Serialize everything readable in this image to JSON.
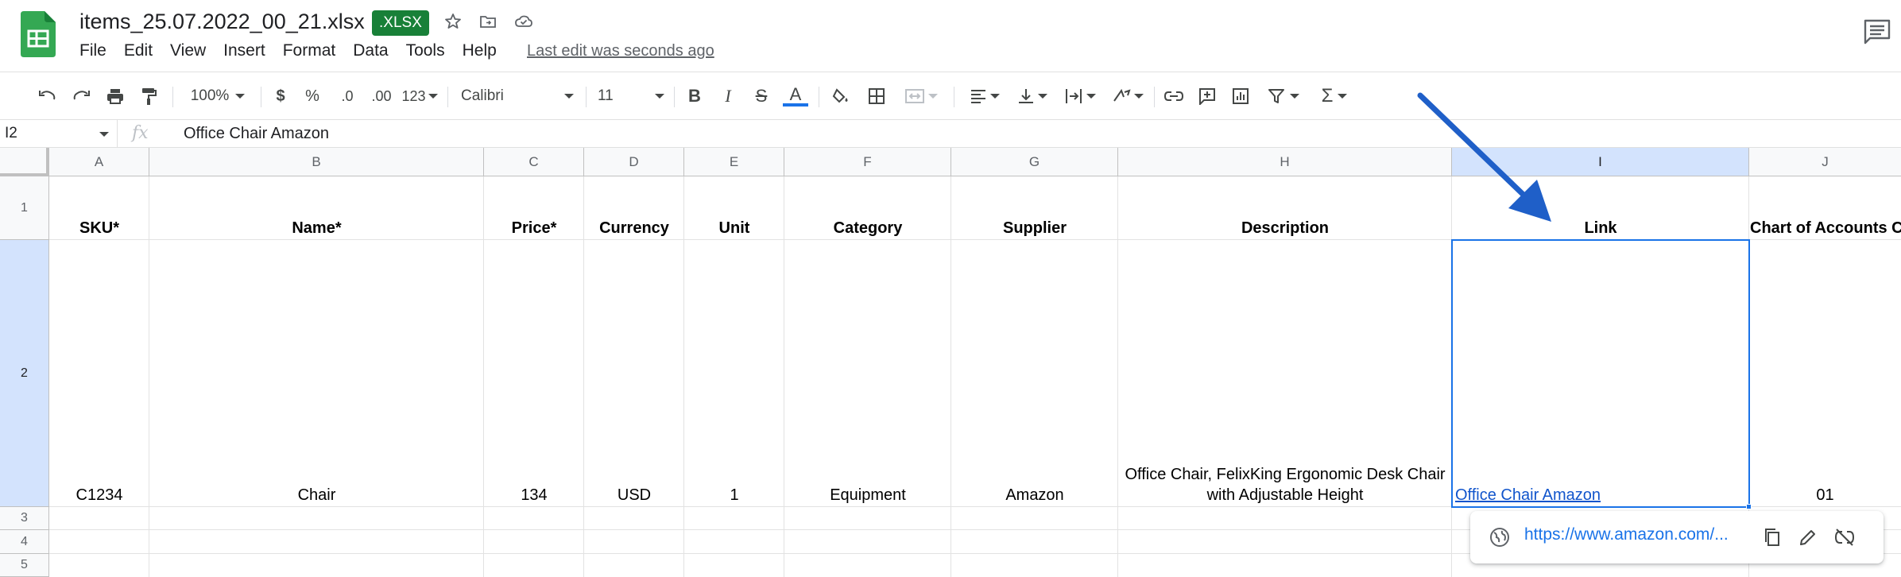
{
  "app": {
    "doc_title": "items_25.07.2022_00_21.xlsx",
    "file_badge": ".XLSX",
    "last_edit": "Last edit was seconds ago",
    "brand_color": "#188038",
    "accent_color": "#1a73e8"
  },
  "menu": [
    "File",
    "Edit",
    "View",
    "Insert",
    "Format",
    "Data",
    "Tools",
    "Help"
  ],
  "toolbar": {
    "zoom": "100%",
    "currency": "$",
    "percent": "%",
    "decrease_decimal": ".0",
    "increase_decimal": ".00",
    "more_formats": "123",
    "font": "Calibri",
    "font_size": "11",
    "bold": "B",
    "italic": "I",
    "strike": "S",
    "text_color": "A",
    "functions": "Σ"
  },
  "formula_bar": {
    "cell_ref": "I2",
    "fx": "fx",
    "value": "Office Chair Amazon"
  },
  "columns": [
    "A",
    "B",
    "C",
    "D",
    "E",
    "F",
    "G",
    "H",
    "I",
    "J"
  ],
  "rows": [
    "1",
    "2",
    "3",
    "4",
    "5"
  ],
  "header_row": [
    "SKU*",
    "Name*",
    "Price*",
    "Currency",
    "Unit",
    "Category",
    "Supplier",
    "Description",
    "Link",
    "Chart of Accounts C"
  ],
  "data_row": {
    "sku": "C1234",
    "name": "Chair",
    "price": "134",
    "currency": "USD",
    "unit": "1",
    "category": "Equipment",
    "supplier": "Amazon",
    "description_line1": "Office Chair, FelixKing Ergonomic Desk Chair",
    "description_line2": "with Adjustable Height",
    "link": "Office Chair Amazon",
    "chart_of_accounts": "01"
  },
  "link_popup": {
    "url": "https://www.amazon.com/..."
  },
  "annotation": {
    "arrow_color": "#1f5fc8"
  }
}
